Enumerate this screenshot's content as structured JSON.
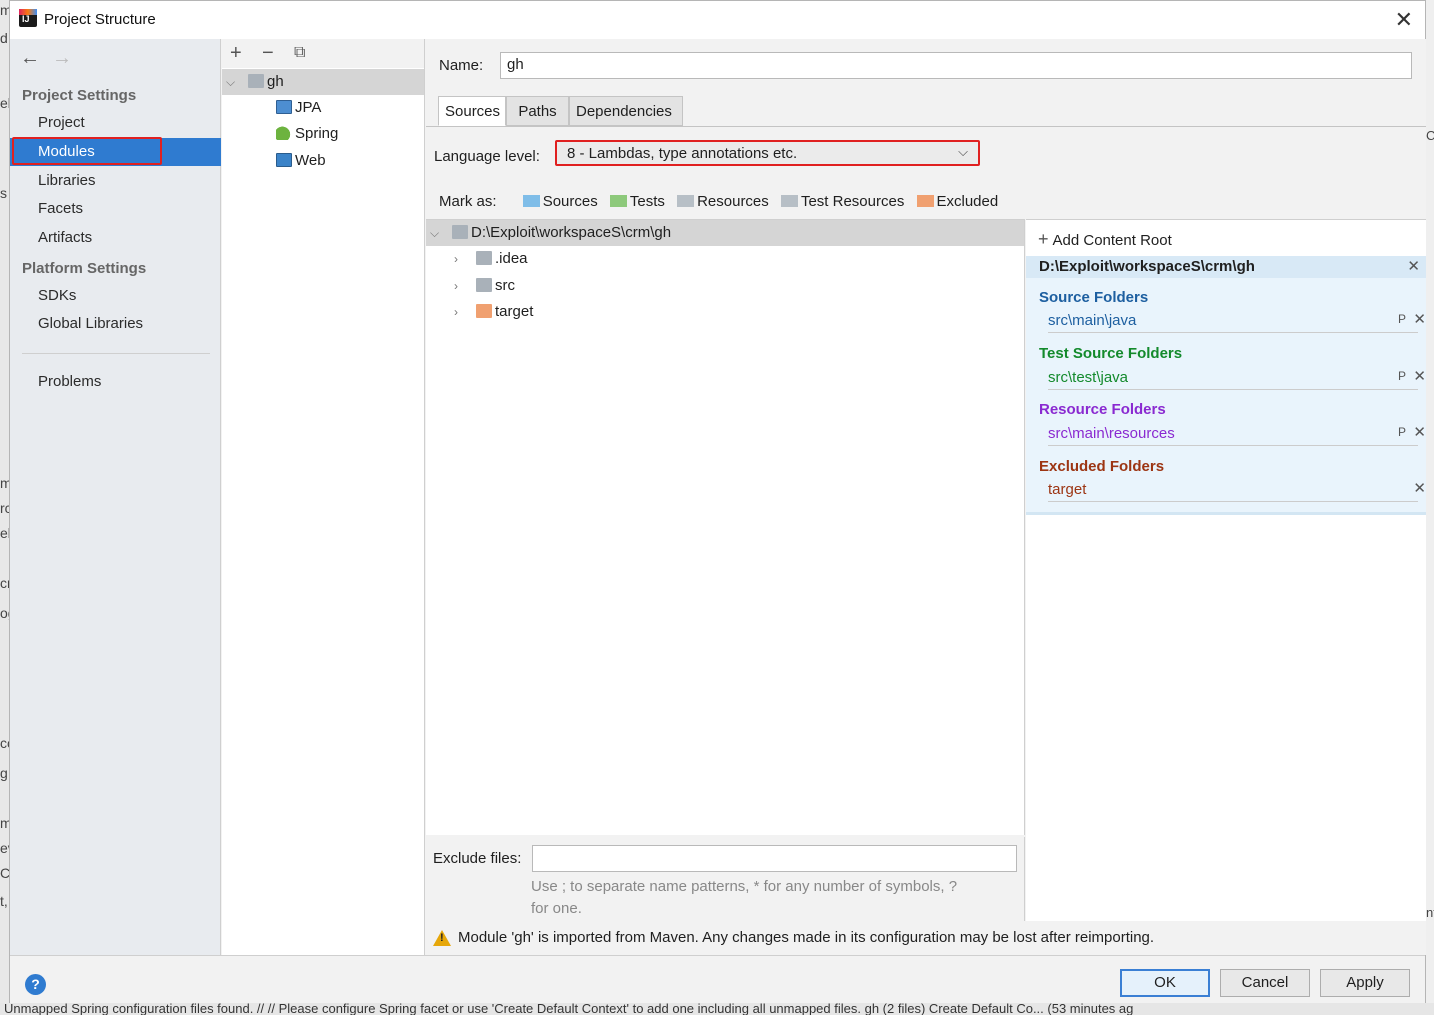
{
  "dialog": {
    "title": "Project Structure"
  },
  "nav": {
    "project_settings": "Project Settings",
    "items_top": [
      "Project",
      "Modules",
      "Libraries",
      "Facets",
      "Artifacts"
    ],
    "platform_settings": "Platform Settings",
    "items_platform": [
      "SDKs",
      "Global Libraries"
    ],
    "problems": "Problems",
    "selected": "Modules"
  },
  "module_tree": {
    "root": "gh",
    "children": [
      "JPA",
      "Spring",
      "Web"
    ]
  },
  "content": {
    "name_label": "Name:",
    "name_value": "gh",
    "tabs": [
      "Sources",
      "Paths",
      "Dependencies"
    ],
    "active_tab": "Sources",
    "language_label": "Language level:",
    "language_value": "8 - Lambdas, type annotations etc.",
    "mark_as_label": "Mark as:",
    "mark_as": [
      {
        "label": "Sources",
        "color": "#7fbde8"
      },
      {
        "label": "Tests",
        "color": "#8dc97b"
      },
      {
        "label": "Resources",
        "color": "#b7bfc6"
      },
      {
        "label": "Test Resources",
        "color": "#b7bfc6"
      },
      {
        "label": "Excluded",
        "color": "#f0a070"
      }
    ],
    "root_path": "D:\\Exploit\\workspaceS\\crm\\gh",
    "root_children": [
      {
        "name": ".idea",
        "color": "#a9b1b9"
      },
      {
        "name": "src",
        "color": "#a9b1b9"
      },
      {
        "name": "target",
        "color": "#f0a070"
      }
    ],
    "exclude_label": "Exclude files:",
    "exclude_value": "",
    "exclude_hint_1": "Use ; to separate name patterns, * for any number of symbols, ?",
    "exclude_hint_2": "for one.",
    "warning": "Module 'gh' is imported from Maven. Any changes made in its configuration may be lost after reimporting."
  },
  "root_panel": {
    "add_content_root": "Add Content Root",
    "root_path": "D:\\Exploit\\workspaceS\\crm\\gh",
    "groups": [
      {
        "title": "Source Folders",
        "color": "#1d5fa0",
        "item": "src\\main\\java",
        "item_color": "#1d5fa0",
        "has_p": true
      },
      {
        "title": "Test Source Folders",
        "color": "#138a2c",
        "item": "src\\test\\java",
        "item_color": "#138a2c",
        "has_p": true
      },
      {
        "title": "Resource Folders",
        "color": "#8a2ad1",
        "item": "src\\main\\resources",
        "item_color": "#8a2ad1",
        "has_p": true
      },
      {
        "title": "Excluded Folders",
        "color": "#9c3513",
        "item": "target",
        "item_color": "#9c3513",
        "has_p": false
      }
    ],
    "p_glyph": "P"
  },
  "footer": {
    "help": "?",
    "ok": "OK",
    "cancel": "Cancel",
    "apply": "Apply"
  },
  "background": {
    "status_bar": "Unmapped Spring configuration files found. // // Please configure Spring facet or use 'Create Default Context' to add one including all unmapped files. gh (2 files)   Create Default Co... (53 minutes ag"
  }
}
